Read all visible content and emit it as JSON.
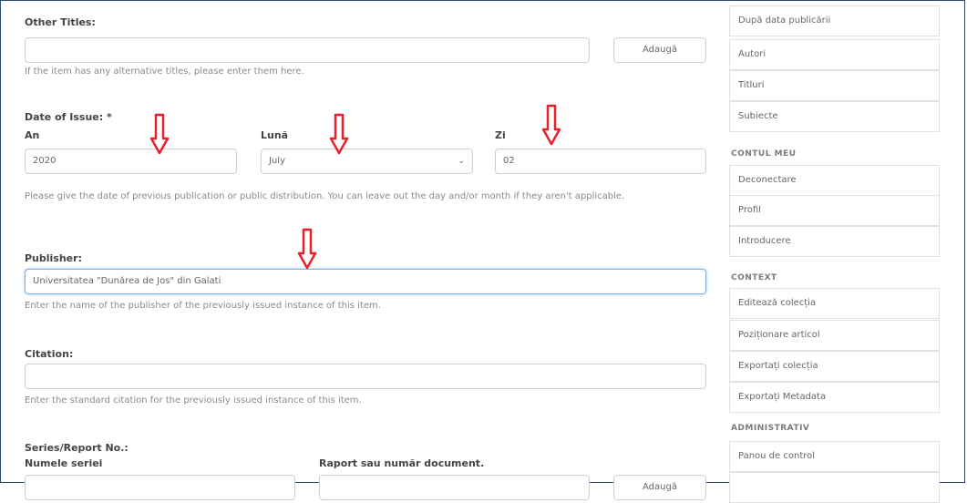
{
  "form": {
    "other_titles": {
      "label": "Other Titles:",
      "value": "",
      "add_label": "Adaugă",
      "help": "If the item has any alternative titles, please enter them here."
    },
    "date_of_issue": {
      "label": "Date of Issue: *",
      "year_label": "An",
      "year_value": "2020",
      "month_label": "Lună",
      "month_value": "July",
      "day_label": "Zi",
      "day_value": "02",
      "help": "Please give the date of previous publication or public distribution. You can leave out the day and/or month if they aren't applicable."
    },
    "publisher": {
      "label": "Publisher:",
      "value": "Universitatea \"Dunărea de Jos\" din Galati",
      "help": "Enter the name of the publisher of the previously issued instance of this item."
    },
    "citation": {
      "label": "Citation:",
      "value": "",
      "help": "Enter the standard citation for the previously issued instance of this item."
    },
    "series": {
      "label": "Series/Report No.:",
      "series_name_label": "Numele seriei",
      "report_label": "Raport sau număr document.",
      "add_label": "Adaugă"
    }
  },
  "sidebar": {
    "browse_items": [
      "După data publicării",
      "Autori",
      "Titluri",
      "Subiecte"
    ],
    "my_account_heading": "CONTUL MEU",
    "my_account_items": [
      "Deconectare",
      "Profil",
      "Introducere"
    ],
    "context_heading": "CONTEXT",
    "context_items": [
      "Editează colecția",
      "Poziționare articol",
      "Exportați colecția",
      "Exportați Metadata"
    ],
    "admin_heading": "ADMINISTRATIV",
    "admin_items": [
      "Panou de control"
    ]
  },
  "colors": {
    "arrow": "#e8202a",
    "focus_border": "#7fb2e0"
  }
}
